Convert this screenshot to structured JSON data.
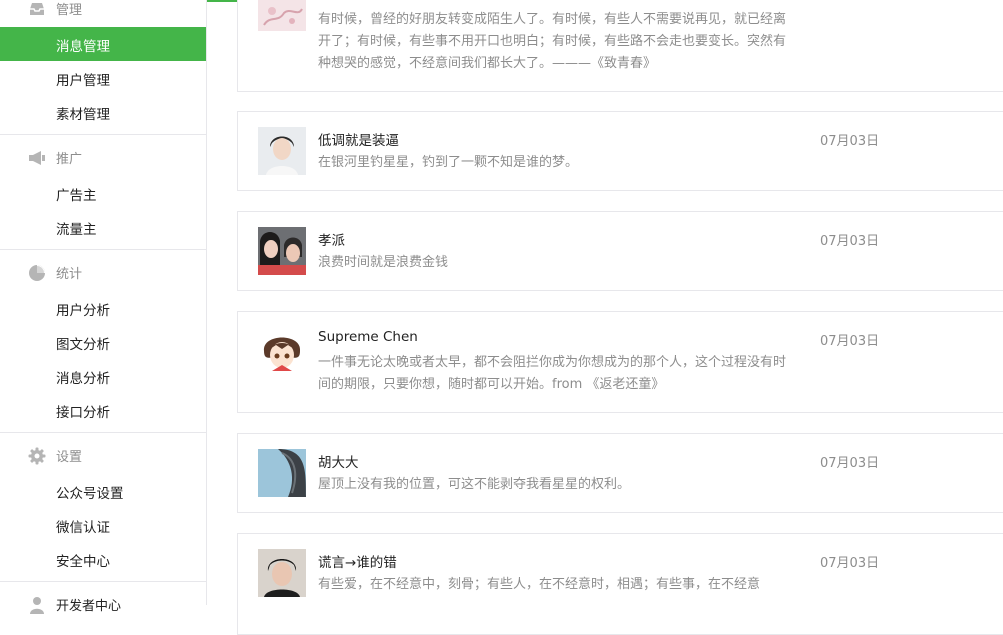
{
  "sidebar": {
    "groups": [
      {
        "title": "管理",
        "icon": "inbox-icon",
        "items": [
          {
            "label": "消息管理",
            "active": true
          },
          {
            "label": "用户管理"
          },
          {
            "label": "素材管理"
          }
        ]
      },
      {
        "title": "推广",
        "icon": "megaphone-icon",
        "items": [
          {
            "label": "广告主"
          },
          {
            "label": "流量主"
          }
        ]
      },
      {
        "title": "统计",
        "icon": "pie-chart-icon",
        "items": [
          {
            "label": "用户分析"
          },
          {
            "label": "图文分析"
          },
          {
            "label": "消息分析"
          },
          {
            "label": "接口分析"
          }
        ]
      },
      {
        "title": "设置",
        "icon": "gear-icon",
        "items": [
          {
            "label": "公众号设置"
          },
          {
            "label": "微信认证"
          },
          {
            "label": "安全中心"
          }
        ]
      },
      {
        "title": "开发者中心",
        "icon": "developer-icon",
        "items": []
      }
    ]
  },
  "colors": {
    "accent": "#44b549",
    "muted": "#8d8d8d",
    "border": "#e7e7eb"
  },
  "messages": [
    {
      "name": "",
      "text": "有时候，曾经的好朋友转变成陌生人了。有时候，有些人不需要说再见，就已经离开了；有时候，有些事不用开口也明白；有时候，有些路不会走也要变长。突然有种想哭的感觉，不经意间我们都长大了。———《致青春》",
      "date": ""
    },
    {
      "name": "低调就是装逼",
      "text": "在银河里钓星星，钓到了一颗不知是谁的梦。",
      "date": "07月03日"
    },
    {
      "name": "孝派",
      "text": "浪费时间就是浪费金钱",
      "date": "07月03日"
    },
    {
      "name": "Supreme Chen",
      "text": "一件事无论太晚或者太早，都不会阻拦你成为你想成为的那个人，这个过程没有时间的期限，只要你想，随时都可以开始。from 《返老还童》",
      "date": "07月03日"
    },
    {
      "name": "胡大大",
      "text": "屋顶上没有我的位置，可这不能剥夺我看星星的权利。",
      "date": "07月03日"
    },
    {
      "name": "谎言→谁的错",
      "text": "有些爱，在不经意中，刻骨；有些人，在不经意时，相遇；有些事，在不经意",
      "date": "07月03日"
    }
  ]
}
